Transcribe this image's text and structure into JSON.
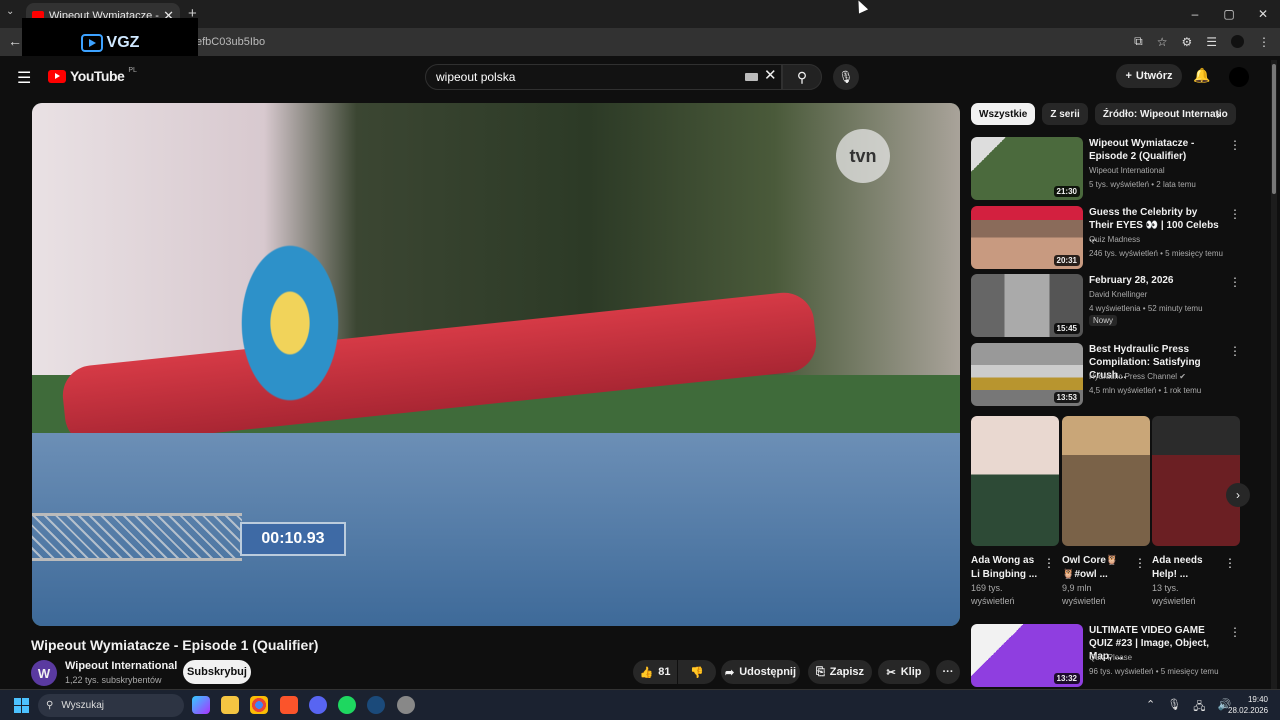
{
  "browser": {
    "tab_title": "Wipeout Wymiatacze - Episode 1",
    "url": "efbC03ub5Ibo",
    "new_tab": "+",
    "dropdown": "⌄",
    "window": {
      "min": "–",
      "max": "▢",
      "close": "✕"
    },
    "back": "←"
  },
  "overlay": {
    "logo_text": "VGZ"
  },
  "header": {
    "logo": "YouTube",
    "country": "PL",
    "search_value": "wipeout polska",
    "clear": "✕",
    "search_icon": "⚲",
    "mic_icon": "🎙",
    "create_label": "Utwórz",
    "plus": "+",
    "bell": "🔔"
  },
  "player": {
    "watermark": "tvn",
    "timer": "00:10.93"
  },
  "video": {
    "title": "Wipeout Wymiatacze - Episode 1 (Qualifier)",
    "channel": "Wipeout International",
    "channel_initial": "W",
    "subs": "1,22 tys. subskrybentów",
    "subscribe": "Subskrybuj",
    "likes": "81",
    "share": "Udostępnij",
    "save": "Zapisz",
    "clip": "Klip",
    "more": "···"
  },
  "chips": [
    "Wszystkie",
    "Z serii",
    "Źródło: Wipeout Internatio"
  ],
  "recommended": [
    {
      "title": "Wipeout Wymiatacze - Episode 2 (Qualifier)",
      "channel": "Wipeout International",
      "meta": "5 tys. wyświetleń • 2 lata temu",
      "duration": "21:30",
      "color": "#5c6e57"
    },
    {
      "title": "Guess the Celebrity by Their EYES 👀 | 100 Celebs ...",
      "channel": "Quiz Madness",
      "meta": "246 tys. wyświetleń • 5 miesięcy temu",
      "duration": "20:31",
      "color": "#c8384d"
    },
    {
      "title": "February 28, 2026",
      "channel": "David Knellinger",
      "meta": "4 wyświetlenia • 52 minuty temu",
      "duration": "15:45",
      "color": "#7d8282",
      "badge": "Nowy"
    },
    {
      "title": "Best Hydraulic Press Compilation: Satisfying Crush...",
      "channel": "Hydraulic Press Channel ✔",
      "meta": "4,5 mln wyświetleń • 1 rok temu",
      "duration": "13:53",
      "color": "#9b9a9a"
    }
  ],
  "shorts": [
    {
      "title": "Ada Wong as Li Bingbing ...",
      "views": "169 tys. wyświetleń",
      "color": "#5b4a44"
    },
    {
      "title": "Owl Core🦉 🦉#owl ...",
      "views": "9,9 mln wyświetleń",
      "color": "#8b7b60"
    },
    {
      "title": "Ada needs Help! ...",
      "views": "13 tys. wyświetleń",
      "color": "#3a2a2a"
    }
  ],
  "last_item": {
    "title": "ULTIMATE VIDEO GAME QUIZ #23 | Image, Object, Map, ...",
    "channel": "Quiz Please",
    "meta": "96 tys. wyświetleń • 5 miesięcy temu",
    "duration": "13:32",
    "color": "#7a3bd0"
  },
  "taskbar": {
    "search": "Wyszukaj",
    "time": "19:40",
    "date": "28.02.2026"
  }
}
